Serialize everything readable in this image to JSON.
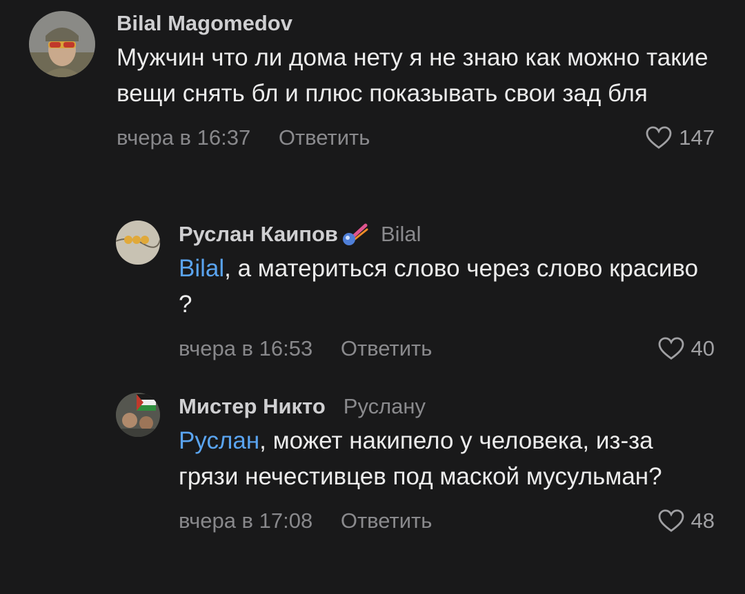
{
  "comments": [
    {
      "author": "Bilal Magomedov",
      "reply_to": "",
      "mention": "",
      "text": "Мужчин что ли дома нету я не знаю как можно такие вещи снять бл и плюс показывать свои зад бля",
      "time": "вчера в 16:37",
      "reply_label": "Ответить",
      "likes": "147"
    },
    {
      "author": "Руслан Каипов",
      "reply_to": "Bilal",
      "mention": "Bilal",
      "text": ", а материться слово через слово красиво ?",
      "time": "вчера в 16:53",
      "reply_label": "Ответить",
      "likes": "40"
    },
    {
      "author": "Мистер Никто",
      "reply_to": "Руслану",
      "mention": "Руслан",
      "text": ", может накипело у человека, из-за грязи нечестивцев  под маской мусульман?",
      "time": "вчера в 17:08",
      "reply_label": "Ответить",
      "likes": "48"
    }
  ],
  "colors": {
    "background": "#19191a",
    "mention": "#5aa4f0",
    "muted": "#88888b"
  },
  "icons": {
    "like": "heart-outline-icon",
    "badge": "comet-emoji-icon"
  }
}
